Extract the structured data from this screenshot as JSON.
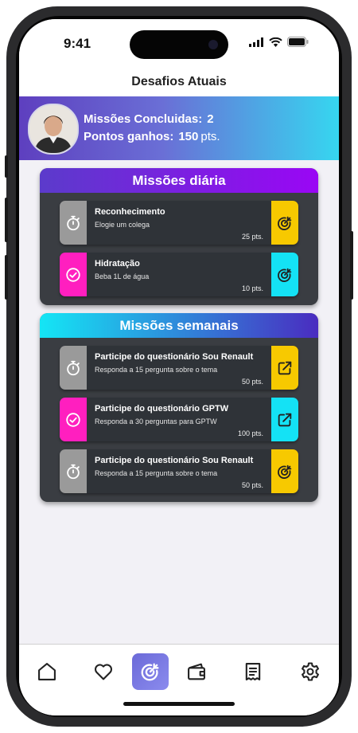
{
  "status_bar": {
    "time": "9:41"
  },
  "header": {
    "title": "Desafios Atuais"
  },
  "profile": {
    "missions_label": "Missões Concluidas:",
    "missions_value": "2",
    "points_label": "Pontos ganhos:",
    "points_value": "150",
    "points_unit": "pts."
  },
  "daily": {
    "title": "Missões diária",
    "missions": [
      {
        "title": "Reconhecimento",
        "desc": "Elogie um colega",
        "points": "25 pts.",
        "status_icon": "stopwatch-icon",
        "action_icon": "target-icon"
      },
      {
        "title": "Hidratação",
        "desc": "Beba 1L de água",
        "points": "10 pts.",
        "status_icon": "check-circle-icon",
        "action_icon": "target-icon"
      }
    ]
  },
  "weekly": {
    "title": "Missões semanais",
    "missions": [
      {
        "title": "Participe do questionário Sou Renault",
        "desc": "Responda a 15 pergunta sobre o tema",
        "points": "50 pts.",
        "status_icon": "stopwatch-icon",
        "action_icon": "external-link-icon"
      },
      {
        "title": "Participe do questionário GPTW",
        "desc": "Responda a 30 perguntas para GPTW",
        "points": "100 pts.",
        "status_icon": "check-circle-icon",
        "action_icon": "external-link-icon"
      },
      {
        "title": "Participe do questionário Sou Renault",
        "desc": "Responda a 15 pergunta sobre o tema",
        "points": "50 pts.",
        "status_icon": "stopwatch-icon",
        "action_icon": "target-icon"
      }
    ]
  },
  "tabbar": {
    "tabs": [
      "home-icon",
      "heart-icon",
      "target-icon",
      "wallet-icon",
      "receipt-icon",
      "gear-icon"
    ],
    "active": "target-icon"
  },
  "colors": {
    "pending_gray": "#9a9a9a",
    "done_magenta": "#ff1fbf",
    "action_yellow": "#f7c900",
    "action_cyan": "#14e2f5",
    "daily_header": [
      "#5b3bcb",
      "#9a06f5"
    ],
    "weekly_header": [
      "#14e6f5",
      "#4a2cc0"
    ]
  }
}
